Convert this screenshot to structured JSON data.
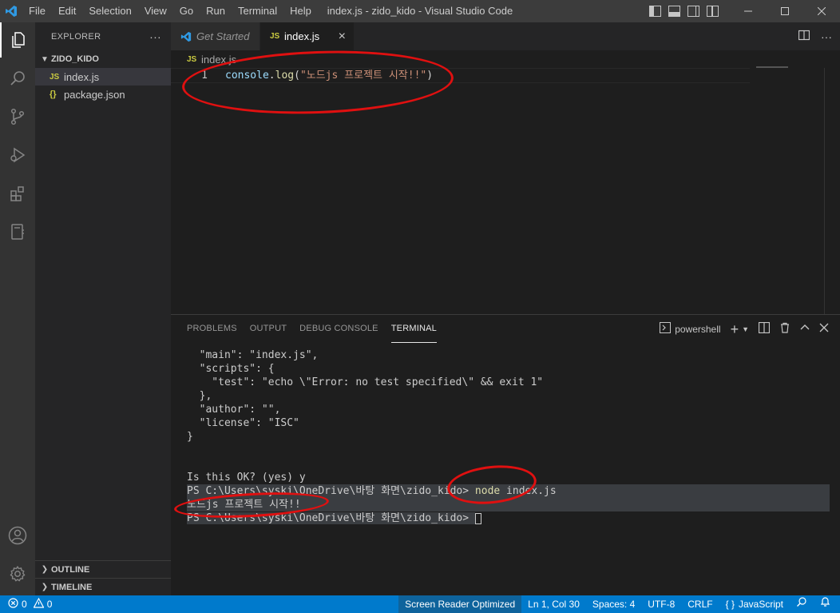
{
  "titlebar": {
    "menu": [
      "File",
      "Edit",
      "Selection",
      "View",
      "Go",
      "Run",
      "Terminal",
      "Help"
    ],
    "title": "index.js - zido_kido - Visual Studio Code"
  },
  "sidebar": {
    "header": "EXPLORER",
    "more": "···",
    "folder": "ZIDO_KIDO",
    "files": [
      {
        "badge": "JS",
        "name": "index.js"
      },
      {
        "badge": "{}",
        "name": "package.json"
      }
    ],
    "outline": "OUTLINE",
    "timeline": "TIMELINE"
  },
  "editor": {
    "tabs": [
      {
        "label": "Get Started"
      },
      {
        "badge": "JS",
        "label": "index.js",
        "close": "×"
      }
    ],
    "breadcrumb_badge": "JS",
    "breadcrumb": "index.js",
    "line_number": "1",
    "code": {
      "object": "console",
      "dot": ".",
      "fn": "log",
      "open": "(",
      "string": "\"노드js 프로젝트 시작!!\"",
      "close": ")"
    }
  },
  "panel": {
    "tabs": [
      "PROBLEMS",
      "OUTPUT",
      "DEBUG CONSOLE",
      "TERMINAL"
    ],
    "active_tab": "TERMINAL",
    "shell": "powershell",
    "terminal_lines": [
      "  \"main\": \"index.js\",",
      "  \"scripts\": {",
      "    \"test\": \"echo \\\"Error: no test specified\\\" && exit 1\"",
      "  },",
      "  \"author\": \"\",",
      "  \"license\": \"ISC\"",
      "}",
      "",
      "",
      "Is this OK? (yes) y"
    ],
    "prompt": "PS C:\\Users\\syski\\OneDrive\\바탕 화면\\zido_kido> ",
    "command_word": "node",
    "command_rest": " index.js",
    "output": "노드js 프로젝트 시작!!",
    "prompt2": "PS C:\\Users\\syski\\OneDrive\\바탕 화면\\zido_kido> "
  },
  "statusbar": {
    "errors": "0",
    "warnings": "0",
    "screen_reader": "Screen Reader Optimized",
    "position": "Ln 1, Col 30",
    "spaces": "Spaces: 4",
    "encoding": "UTF-8",
    "eol": "CRLF",
    "language_icon": "{ }",
    "language": "JavaScript"
  },
  "colors": {
    "accent": "#007acc",
    "annotation": "#e01010",
    "js_badge": "#cbcb41"
  },
  "icons": [
    "vscode-logo-icon",
    "explorer-icon",
    "search-icon",
    "source-control-icon",
    "run-debug-icon",
    "extensions-icon",
    "remote-explorer-icon",
    "account-icon",
    "settings-gear-icon"
  ]
}
